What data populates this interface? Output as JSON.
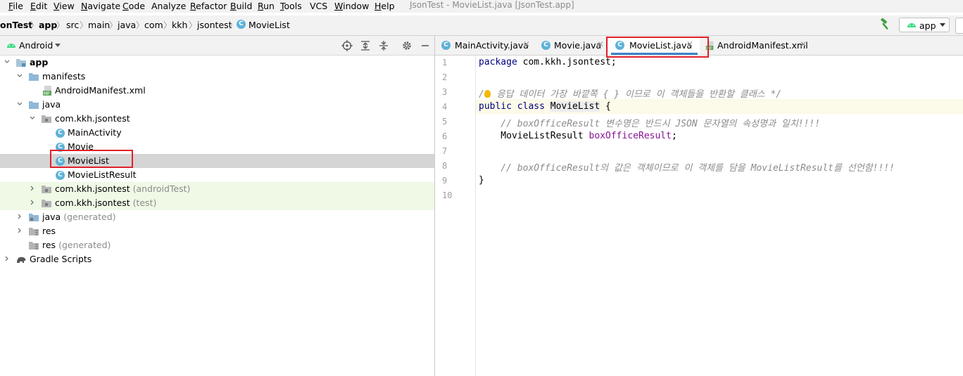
{
  "menu": {
    "items": [
      {
        "mnemonic": "F",
        "rest": "ile"
      },
      {
        "mnemonic": "E",
        "rest": "dit"
      },
      {
        "mnemonic": "V",
        "rest": "iew"
      },
      {
        "mnemonic": "N",
        "rest": "avigate"
      },
      {
        "mnemonic": "C",
        "rest": "ode"
      },
      {
        "mnemonic": "",
        "rest": "Analyze"
      },
      {
        "mnemonic": "R",
        "rest": "efactor"
      },
      {
        "mnemonic": "B",
        "rest": "uild"
      },
      {
        "mnemonic": "R",
        "rest": "un"
      },
      {
        "mnemonic": "T",
        "rest": "ools"
      },
      {
        "mnemonic": "",
        "rest": "VCS"
      },
      {
        "mnemonic": "W",
        "rest": "indow"
      },
      {
        "mnemonic": "H",
        "rest": "elp"
      }
    ],
    "window_title": "JsonTest - MovieList.java [JsonTest.app]"
  },
  "breadcrumb": [
    "onTest",
    "app",
    "src",
    "main",
    "java",
    "com",
    "kkh",
    "jsontest",
    "MovieList"
  ],
  "run_config": {
    "label": "app"
  },
  "project_panel": {
    "view_label": "Android",
    "tree": [
      {
        "label": "app",
        "hint": ""
      },
      {
        "label": "manifests",
        "hint": ""
      },
      {
        "label": "AndroidManifest.xml",
        "hint": ""
      },
      {
        "label": "java",
        "hint": ""
      },
      {
        "label": "com.kkh.jsontest",
        "hint": ""
      },
      {
        "label": "MainActivity",
        "hint": ""
      },
      {
        "label": "Movie",
        "hint": ""
      },
      {
        "label": "MovieList",
        "hint": ""
      },
      {
        "label": "MovieListResult",
        "hint": ""
      },
      {
        "label": "com.kkh.jsontest",
        "hint": "(androidTest)"
      },
      {
        "label": "com.kkh.jsontest",
        "hint": "(test)"
      },
      {
        "label": "java",
        "hint": "(generated)"
      },
      {
        "label": "res",
        "hint": ""
      },
      {
        "label": "res",
        "hint": "(generated)"
      },
      {
        "label": "Gradle Scripts",
        "hint": ""
      }
    ]
  },
  "tabs": [
    {
      "label": "MainActivity.java",
      "icon": "class-icon"
    },
    {
      "label": "Movie.java",
      "icon": "class-icon"
    },
    {
      "label": "MovieList.java",
      "icon": "class-icon",
      "active": true
    },
    {
      "label": "AndroidManifest.xml",
      "icon": "manifest-icon"
    }
  ],
  "editor": {
    "line_numbers": [
      "1",
      "2",
      "3",
      "4",
      "5",
      "6",
      "7",
      "8",
      "9",
      "10"
    ],
    "lines": {
      "l1_kw": "package",
      "l1_rest": " com.kkh.jsontest;",
      "l3_pre": "/",
      "l3_post": " 응답 데이터 가장 바깥쪽 { } 이므로 이 객체들을 반환할 클래스 */",
      "l4_kw": "public class",
      "l4_cls": "MovieList",
      "l4_rest": " {",
      "l5": "    // boxOfficeResult 변수명은 반드시 JSON 문자열의 속성명과 일치!!!!",
      "l6_type": "    MovieListResult ",
      "l6_field": "boxOfficeResult",
      "l6_end": ";",
      "l8": "    // boxOfficeResult의 값은 객체이므로 이 객체를 담을 MovieListResult를 선언함!!!!",
      "l9": "}"
    }
  },
  "colors": {
    "accent": "#4083c9",
    "highlight_box": "#e0202a",
    "class_icon": "#5eb2d8",
    "keyword": "#000080",
    "field": "#871094",
    "comment": "#8c8c8c"
  }
}
